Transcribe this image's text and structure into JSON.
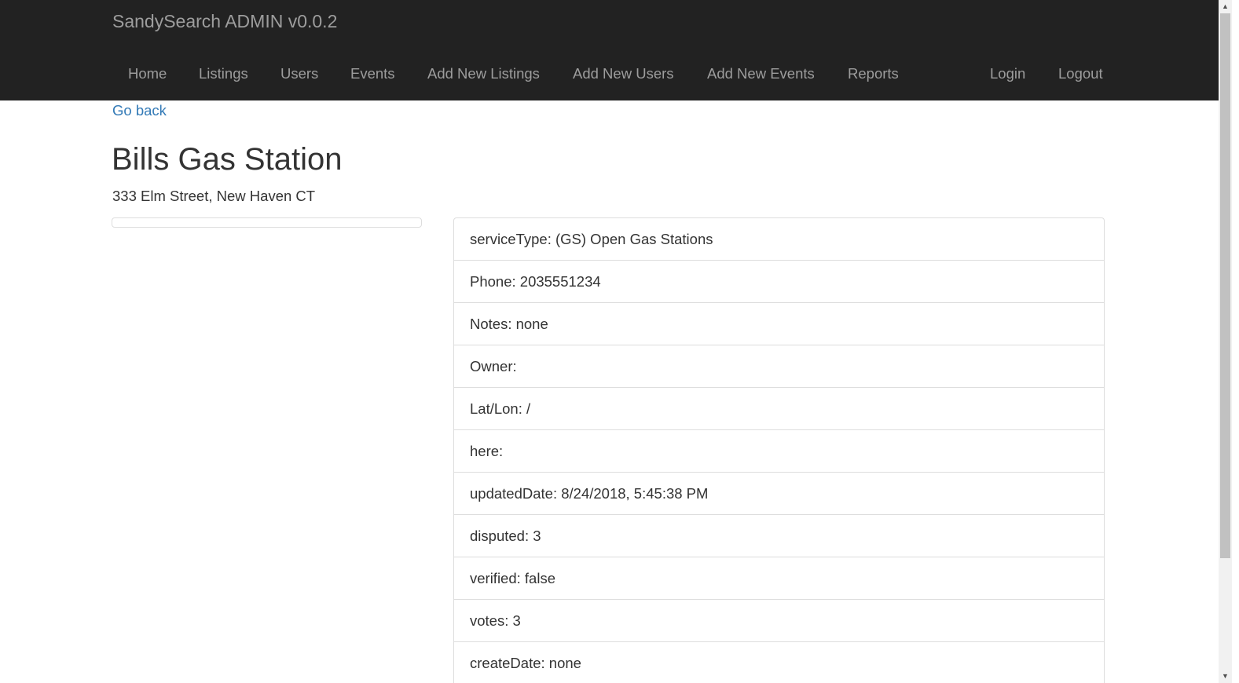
{
  "navbar": {
    "brand": "SandySearch ADMIN v0.0.2",
    "items": [
      {
        "label": "Home"
      },
      {
        "label": "Listings"
      },
      {
        "label": "Users"
      },
      {
        "label": "Events"
      },
      {
        "label": "Add New Listings"
      },
      {
        "label": "Add New Users"
      },
      {
        "label": "Add New Events"
      },
      {
        "label": "Reports"
      }
    ],
    "right_items": [
      {
        "label": "Login"
      },
      {
        "label": "Logout"
      }
    ]
  },
  "main": {
    "go_back": "Go back",
    "title": "Bills Gas Station",
    "address": "333 Elm Street, New Haven CT",
    "details": [
      "serviceType: (GS) Open Gas Stations",
      "Phone: 2035551234",
      "Notes: none",
      "Owner:",
      "Lat/Lon: /",
      "here:",
      "updatedDate: 8/24/2018, 5:45:38 PM",
      "disputed: 3",
      "verified: false",
      "votes: 3",
      "createDate: none"
    ]
  },
  "colors": {
    "navbar_bg": "#222222",
    "nav_text": "#9d9d9d",
    "link": "#337ab7",
    "border": "#dddddd"
  }
}
